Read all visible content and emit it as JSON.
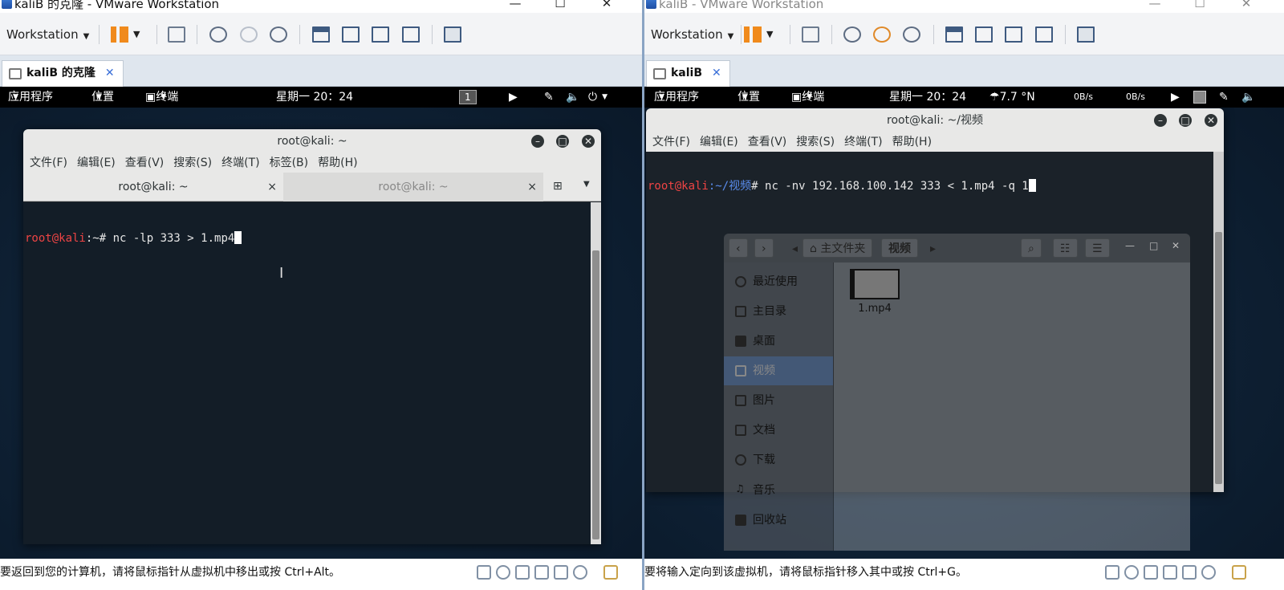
{
  "left": {
    "window_title": "kaliB 的克隆 - VMware Workstation",
    "toolbar": {
      "workstation_label": "Workstation"
    },
    "tab_label": "kaliB 的克隆",
    "gnome": {
      "apps": "应用程序",
      "places": "位置",
      "terminal": "终端",
      "clock": "星期一 20：24",
      "workspace": "1"
    },
    "terminal": {
      "title": "root@kali: ~",
      "menus": [
        "文件(F)",
        "编辑(E)",
        "查看(V)",
        "搜索(S)",
        "终端(T)",
        "标签(B)",
        "帮助(H)"
      ],
      "tabs": [
        {
          "label": "root@kali: ~",
          "close": "×"
        },
        {
          "label": "root@kali: ~",
          "close": "×"
        }
      ],
      "prompt_user": "root@kali",
      "prompt_path": ":~",
      "prompt_sym": "# ",
      "command": "nc -lp 333 > 1.mp4"
    },
    "status_message": "要返回到您的计算机，请将鼠标指针从虚拟机中移出或按 Ctrl+Alt。"
  },
  "right": {
    "window_title": "kaliB - VMware Workstation",
    "toolbar": {
      "workstation_label": "Workstation"
    },
    "tab_label": "kaliB",
    "gnome": {
      "apps": "应用程序",
      "places": "位置",
      "terminal": "终端",
      "clock": "星期一 20：24",
      "weather": "7.7 °N",
      "net_down": "0B/s",
      "net_up": "0B/s"
    },
    "terminal": {
      "title": "root@kali: ~/视频",
      "menus": [
        "文件(F)",
        "编辑(E)",
        "查看(V)",
        "搜索(S)",
        "终端(T)",
        "帮助(H)"
      ],
      "prompt_user": "root@kali",
      "prompt_path": ":~/视频",
      "prompt_sym": "# ",
      "command": "nc -nv 192.168.100.142 333 < 1.mp4 -q 1"
    },
    "file_manager": {
      "crumb_home": "主文件夹",
      "crumb_current": "视频",
      "sidebar": [
        "最近使用",
        "主目录",
        "桌面",
        "视频",
        "图片",
        "文档",
        "下载",
        "音乐",
        "回收站"
      ],
      "file_name": "1.mp4"
    },
    "status_message": "要将输入定向到该虚拟机，请将鼠标指针移入其中或按 Ctrl+G。"
  }
}
